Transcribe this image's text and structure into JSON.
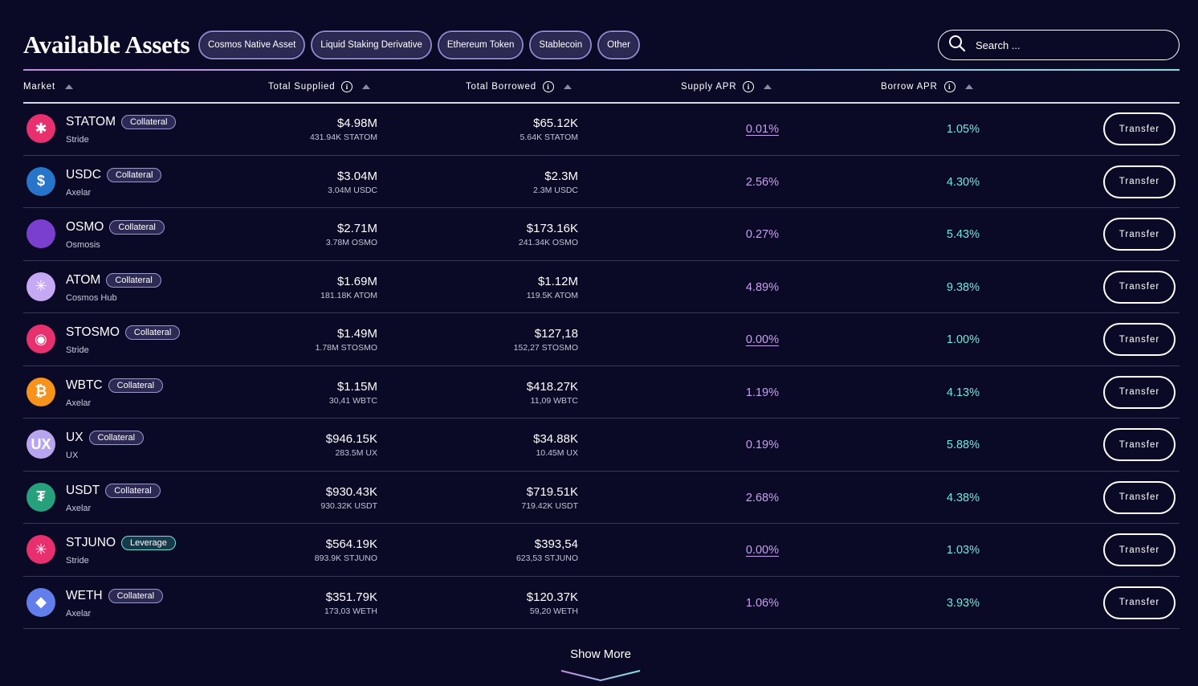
{
  "header": {
    "title": "Available Assets",
    "filters": [
      "Cosmos Native Asset",
      "Liquid Staking Derivative",
      "Ethereum Token",
      "Stablecoin",
      "Other"
    ],
    "search_placeholder": "Search ..."
  },
  "columns": {
    "market": "Market",
    "total_supplied": "Total Supplied",
    "total_borrowed": "Total Borrowed",
    "supply_apr": "Supply APR",
    "borrow_apr": "Borrow APR"
  },
  "rows": [
    {
      "symbol": "STATOM",
      "badge": "Collateral",
      "chain": "Stride",
      "supplied": "$4.98M",
      "supplied_sub": "431.94K STATOM",
      "borrowed": "$65.12K",
      "borrowed_sub": "5.64K STATOM",
      "supply_apr": "0.01%",
      "borrow_apr": "1.05%",
      "action": "Transfer",
      "icon": "stride-atom-icon",
      "icon_color": "#e8306f"
    },
    {
      "symbol": "USDC",
      "badge": "Collateral",
      "chain": "Axelar",
      "supplied": "$3.04M",
      "supplied_sub": "3.04M USDC",
      "borrowed": "$2.3M",
      "borrowed_sub": "2.3M USDC",
      "supply_apr": "2.56%",
      "borrow_apr": "4.30%",
      "action": "Transfer",
      "icon": "usdc-icon",
      "icon_color": "#2775ca"
    },
    {
      "symbol": "OSMO",
      "badge": "Collateral",
      "chain": "Osmosis",
      "supplied": "$2.71M",
      "supplied_sub": "3.78M OSMO",
      "borrowed": "$173.16K",
      "borrowed_sub": "241.34K OSMO",
      "supply_apr": "0.27%",
      "borrow_apr": "5.43%",
      "action": "Transfer",
      "icon": "osmo-icon",
      "icon_color": "#7b3fd0"
    },
    {
      "symbol": "ATOM",
      "badge": "Collateral",
      "chain": "Cosmos Hub",
      "supplied": "$1.69M",
      "supplied_sub": "181.18K ATOM",
      "borrowed": "$1.12M",
      "borrowed_sub": "119.5K ATOM",
      "supply_apr": "4.89%",
      "borrow_apr": "9.38%",
      "action": "Transfer",
      "icon": "atom-icon",
      "icon_color": "#c6a9f5"
    },
    {
      "symbol": "STOSMO",
      "badge": "Collateral",
      "chain": "Stride",
      "supplied": "$1.49M",
      "supplied_sub": "1.78M STOSMO",
      "borrowed": "$127,18",
      "borrowed_sub": "152,27 STOSMO",
      "supply_apr": "0.00%",
      "borrow_apr": "1.00%",
      "action": "Transfer",
      "icon": "stride-osmo-icon",
      "icon_color": "#e8306f"
    },
    {
      "symbol": "WBTC",
      "badge": "Collateral",
      "chain": "Axelar",
      "supplied": "$1.15M",
      "supplied_sub": "30,41 WBTC",
      "borrowed": "$418.27K",
      "borrowed_sub": "11,09 WBTC",
      "supply_apr": "1.19%",
      "borrow_apr": "4.13%",
      "action": "Transfer",
      "icon": "bitcoin-icon",
      "icon_color": "#f7931a"
    },
    {
      "symbol": "UX",
      "badge": "Collateral",
      "chain": "UX",
      "supplied": "$946.15K",
      "supplied_sub": "283.5M UX",
      "borrowed": "$34.88K",
      "borrowed_sub": "10.45M UX",
      "supply_apr": "0.19%",
      "borrow_apr": "5.88%",
      "action": "Transfer",
      "icon": "ux-icon",
      "icon_color": "#b9a4f0"
    },
    {
      "symbol": "USDT",
      "badge": "Collateral",
      "chain": "Axelar",
      "supplied": "$930.43K",
      "supplied_sub": "930.32K USDT",
      "borrowed": "$719.51K",
      "borrowed_sub": "719.42K USDT",
      "supply_apr": "2.68%",
      "borrow_apr": "4.38%",
      "action": "Transfer",
      "icon": "tether-icon",
      "icon_color": "#26a17b"
    },
    {
      "symbol": "STJUNO",
      "badge": "Leverage",
      "chain": "Stride",
      "supplied": "$564.19K",
      "supplied_sub": "893.9K STJUNO",
      "borrowed": "$393,54",
      "borrowed_sub": "623,53 STJUNO",
      "supply_apr": "0.00%",
      "borrow_apr": "1.03%",
      "action": "Transfer",
      "icon": "stride-juno-icon",
      "icon_color": "#e8306f"
    },
    {
      "symbol": "WETH",
      "badge": "Collateral",
      "chain": "Axelar",
      "supplied": "$351.79K",
      "supplied_sub": "173,03 WETH",
      "borrowed": "$120.37K",
      "borrowed_sub": "59,20 WETH",
      "supply_apr": "1.06%",
      "borrow_apr": "3.93%",
      "action": "Transfer",
      "icon": "ethereum-icon",
      "icon_color": "#627eea"
    }
  ],
  "footer": {
    "show_more": "Show More"
  },
  "colors": {
    "background": "#0b0a26",
    "supply_apr": "#c7a0ee",
    "borrow_apr": "#6fe8de"
  }
}
